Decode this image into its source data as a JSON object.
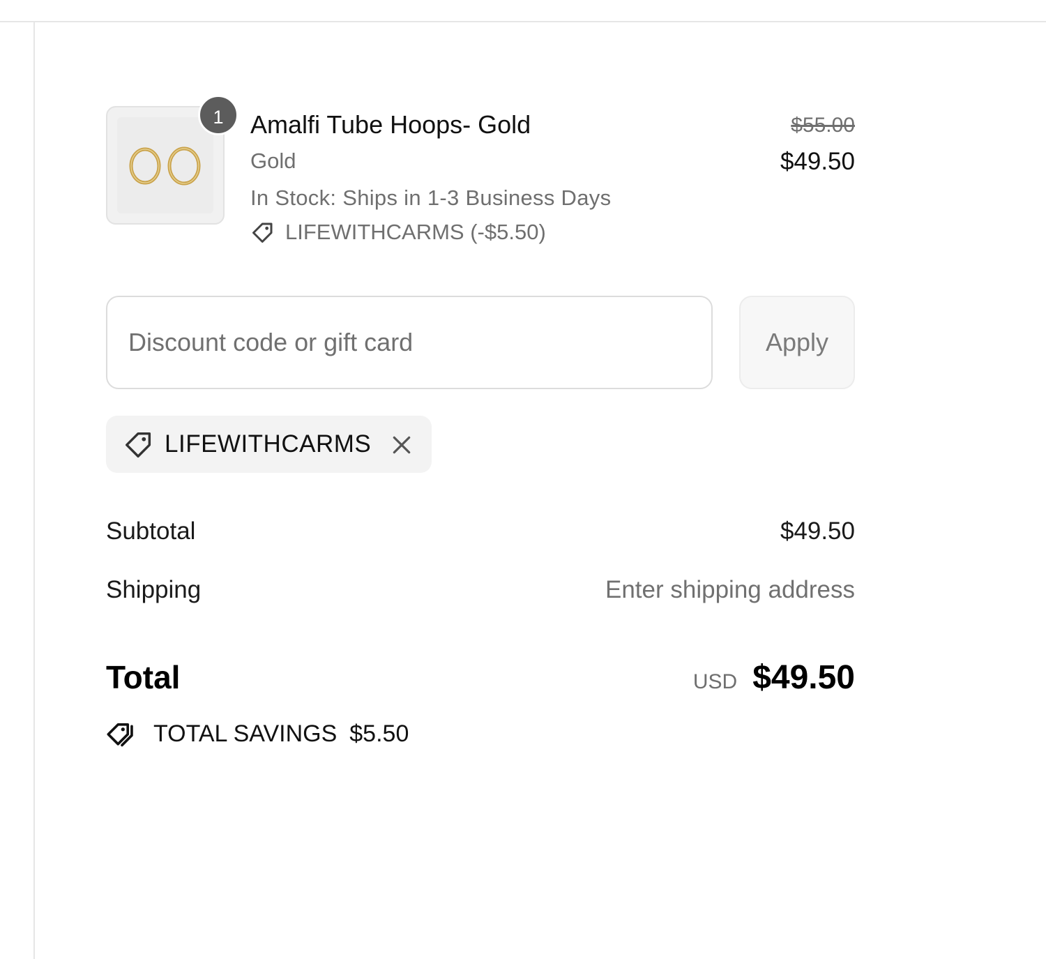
{
  "product": {
    "quantity": "1",
    "title": "Amalfi Tube Hoops- Gold",
    "variant": "Gold",
    "stock": "In Stock: Ships in 1-3 Business Days",
    "discount_line": "LIFEWITHCARMS (-$5.50)",
    "original_price": "$55.00",
    "price": "$49.50",
    "image_icon": "gold-hoop-earrings-image"
  },
  "discount": {
    "placeholder": "Discount code or gift card",
    "value": "",
    "apply_label": "Apply",
    "applied_code": "LIFEWITHCARMS"
  },
  "totals": {
    "subtotal_label": "Subtotal",
    "subtotal_value": "$49.50",
    "shipping_label": "Shipping",
    "shipping_value": "Enter shipping address",
    "total_label": "Total",
    "currency": "USD",
    "total_value": "$49.50",
    "savings_label": "TOTAL SAVINGS",
    "savings_value": "$5.50"
  },
  "colors": {
    "text": "#1a1a1a",
    "muted": "#6f6f6f",
    "badge": "#5c5c5c",
    "border": "#dcdcdc",
    "chip_bg": "#f3f3f3",
    "gold": "#c9a24a"
  }
}
